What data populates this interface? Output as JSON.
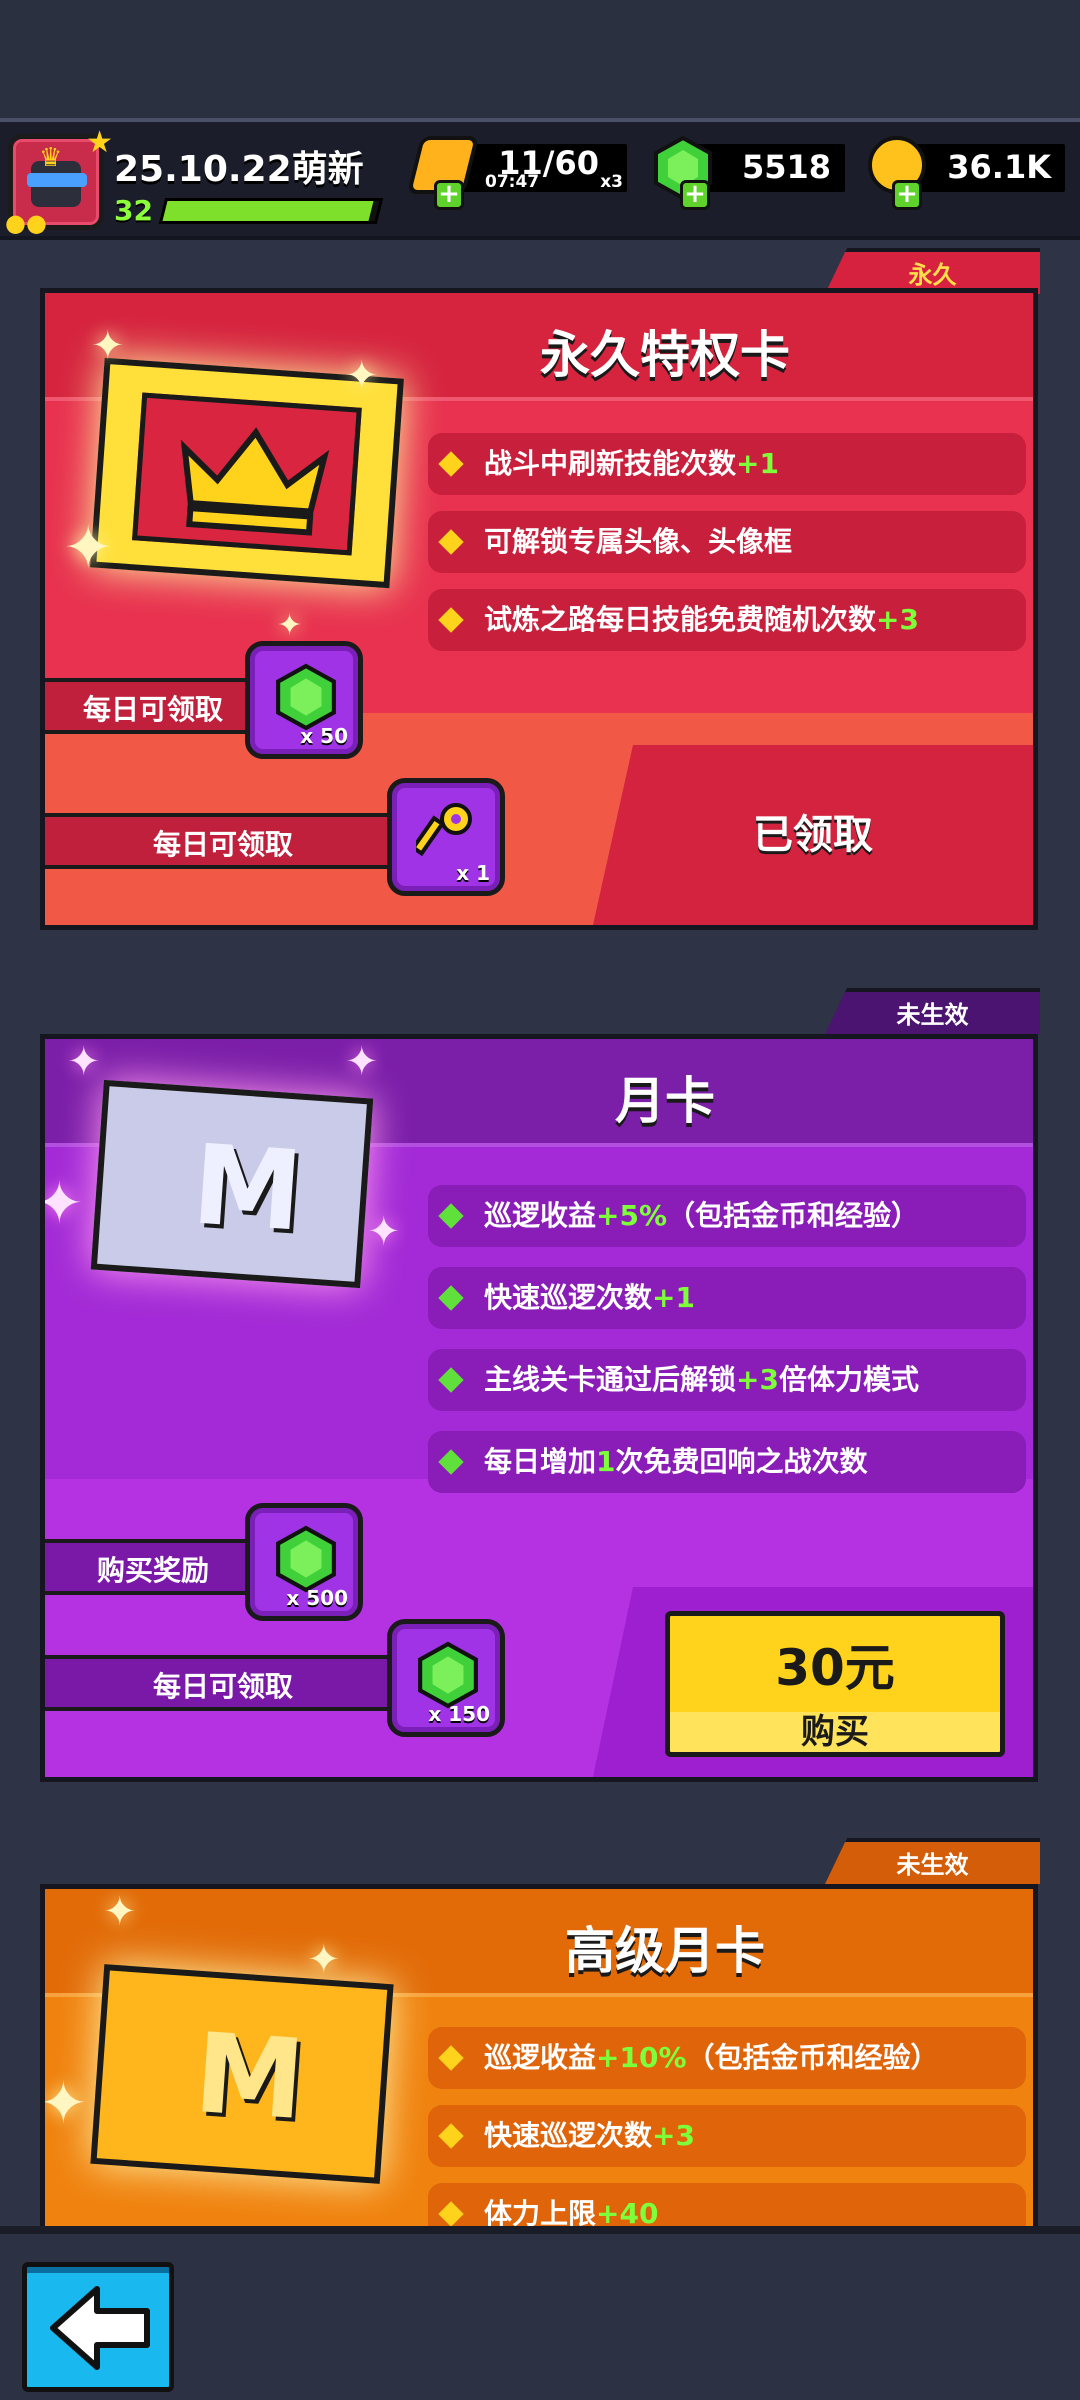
{
  "header": {
    "player_name": "25.10.22萌新",
    "level": "32",
    "xp_fraction": 0.97,
    "energy": {
      "value": "11/60",
      "timer": "07:47",
      "multiplier": "x3"
    },
    "gems": "5518",
    "coins": "36.1K"
  },
  "cards": {
    "permanent": {
      "status": "永久",
      "title": "永久特权卡",
      "perks": [
        {
          "text": "战斗中刷新技能次数",
          "highlight": "+1",
          "after": ""
        },
        {
          "text": "可解锁专属头像、头像框",
          "highlight": "",
          "after": ""
        },
        {
          "text": "试炼之路每日技能免费随机次数",
          "highlight": "+3",
          "after": ""
        }
      ],
      "rewards": [
        {
          "label": "每日可领取",
          "icon": "gem-icon",
          "qty": "x 50"
        },
        {
          "label": "每日可领取",
          "icon": "key-icon",
          "qty": "x 1"
        }
      ],
      "action": "已领取"
    },
    "monthly": {
      "status": "未生效",
      "title": "月卡",
      "perks": [
        {
          "text": "巡逻收益",
          "highlight": "+5%",
          "after": "（包括金币和经验）"
        },
        {
          "text": "快速巡逻次数",
          "highlight": "+1",
          "after": ""
        },
        {
          "text": "主线关卡通过后解锁",
          "highlight": "+3",
          "after": "倍体力模式"
        },
        {
          "text": "每日增加",
          "highlight": "1",
          "after": "次免费回响之战次数"
        }
      ],
      "rewards": [
        {
          "label": "购买奖励",
          "icon": "gem-icon",
          "qty": "x 500"
        },
        {
          "label": "每日可领取",
          "icon": "gem-icon",
          "qty": "x 150"
        }
      ],
      "price": "30元",
      "buy_label": "购买"
    },
    "premium": {
      "status": "未生效",
      "title": "高级月卡",
      "perks": [
        {
          "text": "巡逻收益",
          "highlight": "+10%",
          "after": "（包括金币和经验）"
        },
        {
          "text": "快速巡逻次数",
          "highlight": "+3",
          "after": ""
        },
        {
          "text": "体力上限",
          "highlight": "+40",
          "after": ""
        }
      ]
    }
  },
  "colors": {
    "permanent_bg": "#e8324f",
    "monthly_bg": "#a32ad6",
    "premium_bg": "#f0820f",
    "highlight": "#7dff3a",
    "buy_button": "#ffd21c",
    "back_button": "#19b8ef"
  }
}
